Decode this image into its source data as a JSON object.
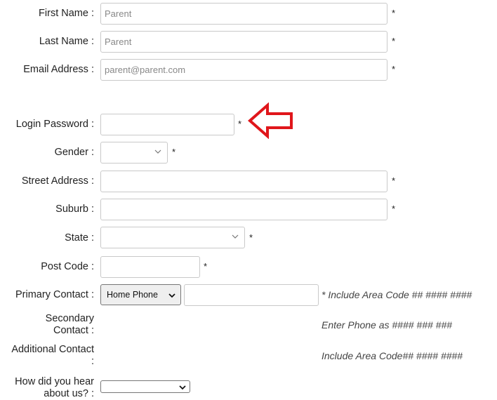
{
  "form": {
    "first_name": {
      "label": "First Name :",
      "value": "Parent",
      "required": "*"
    },
    "last_name": {
      "label": "Last Name :",
      "value": "Parent",
      "required": "*"
    },
    "email": {
      "label": "Email Address :",
      "value": "parent@parent.com",
      "required": "*"
    },
    "password": {
      "label": "Login Password :",
      "value": "",
      "required": "*"
    },
    "gender": {
      "label": "Gender :",
      "value": "",
      "required": "*"
    },
    "street": {
      "label": "Street Address :",
      "value": "",
      "required": "*"
    },
    "suburb": {
      "label": "Suburb :",
      "value": "",
      "required": "*"
    },
    "state": {
      "label": "State :",
      "value": "",
      "required": "*"
    },
    "postcode": {
      "label": "Post Code :",
      "value": "",
      "required": "*"
    },
    "primary_contact": {
      "label": "Primary Contact :",
      "type_selected": "Home Phone",
      "value": "",
      "hint": "* Include Area Code ## #### ####"
    },
    "secondary_contact": {
      "label_line1": "Secondary",
      "label_line2": "Contact :",
      "hint": "Enter Phone as #### ### ###"
    },
    "additional_contact": {
      "label_line1": "Additional Contact",
      "label_line2": ":",
      "hint": "Include Area Code## #### ####"
    },
    "heard_about": {
      "label_line1": "How did you hear",
      "label_line2": "about us? :",
      "selected": ""
    }
  },
  "annotation": {
    "icon": "arrow-left-icon",
    "color": "#e0161b"
  },
  "colors": {
    "input_border": "#c9c9c9",
    "placeholder_text": "#888888"
  }
}
